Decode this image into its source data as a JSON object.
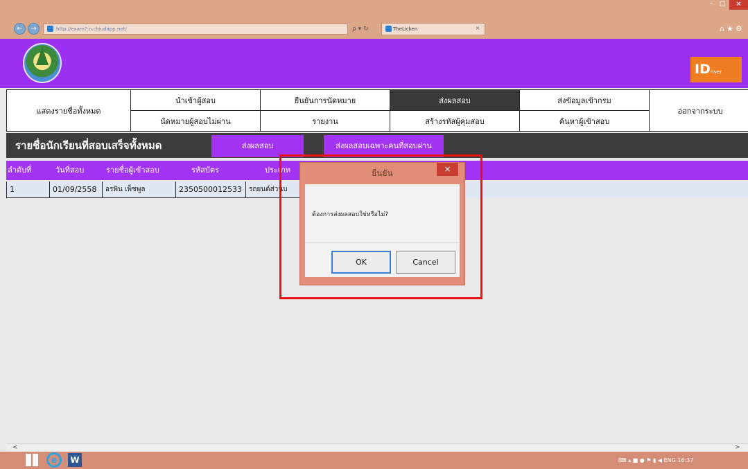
{
  "browser": {
    "back_icon": "←",
    "forward_icon": "→",
    "url": "http://exam?:n.cloudapp.net/",
    "search_icon": "search-icon",
    "address_tools": "ρ ▾ ↻",
    "tab_title": "TheLicken",
    "tab_close": "×",
    "window_min": "–",
    "window_max": "□",
    "window_close": "✕",
    "right_icons": "⌂★⚙"
  },
  "header": {
    "logo_icon": "government-seal-icon",
    "badge_text": "ID",
    "badge_sub": "river",
    "banner_color": "#9b30f0"
  },
  "nav": {
    "show_all": "แสดงรายชื่อทั้งหมด",
    "import_candidate": "นำเข้าผู้สอบ",
    "confirm_appointment": "ยืนยันการนัดหมาย",
    "send_results": "ส่งผลสอบ",
    "send_training_data": "ส่งข้อมูลเข้ากรม",
    "logout": "ออกจากระบบ",
    "failed_appointment": "นัดหมายผู้สอบไม่ผ่าน",
    "report": "รายงาน",
    "create_proctor_code": "สร้างรหัสผู้คุมสอบ",
    "search_candidate": "ค้นหาผู้เข้าสอบ",
    "active_color": "#3a3a3a"
  },
  "section": {
    "title": "รายชื่อนักเรียนที่สอบเสร็จทั้งหมด",
    "send_button": "ส่งผลสอบ",
    "send_passed_button": "ส่งผลสอบเฉพาะคนที่สอบผ่าน"
  },
  "table": {
    "headers": [
      "ลำดับที่",
      "วันที่สอบ",
      "รายชื่อผู้เข้าสอบ",
      "รหัสบัตร",
      "ประเภท"
    ],
    "row": {
      "no": "1",
      "date": "01/09/2558",
      "name": "อรพิน เพ็ชพูล",
      "id": "2350500012533",
      "type": "รถยนต์ส่วนบ"
    }
  },
  "dialog": {
    "title": "ยืนยัน",
    "close": "×",
    "message": "ต้องการส่งผลสอบใช่หรือไม่?",
    "ok": "OK",
    "cancel": "Cancel",
    "highlight_color": "#ee1111"
  },
  "scrollbar": {
    "left": "<",
    "right": ">"
  },
  "taskbar": {
    "start_icon": "windows-start-icon",
    "ie_label": "e",
    "word_label": "W",
    "tray": "⌨  ▴ ■ ● ⚑ ▮ ◀  ENG  16:37"
  }
}
